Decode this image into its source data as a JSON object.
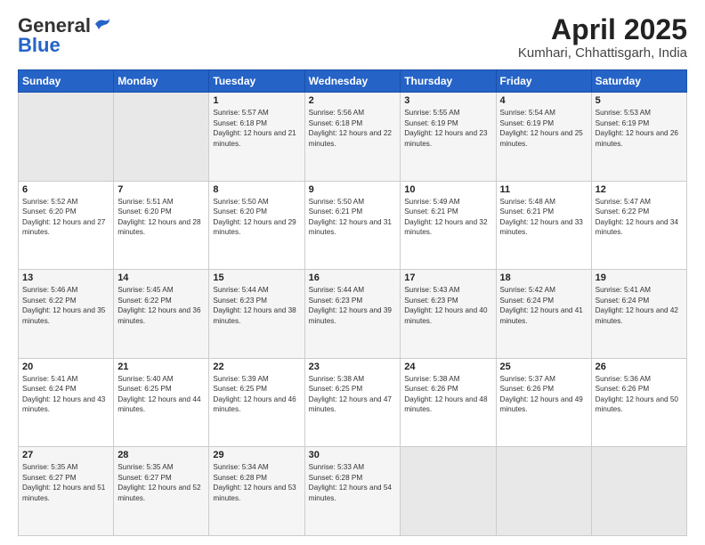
{
  "header": {
    "logo_general": "General",
    "logo_blue": "Blue",
    "title": "April 2025",
    "subtitle": "Kumhari, Chhattisgarh, India"
  },
  "weekdays": [
    "Sunday",
    "Monday",
    "Tuesday",
    "Wednesday",
    "Thursday",
    "Friday",
    "Saturday"
  ],
  "weeks": [
    [
      {
        "day": "",
        "sunrise": "",
        "sunset": "",
        "daylight": "",
        "empty": true
      },
      {
        "day": "",
        "sunrise": "",
        "sunset": "",
        "daylight": "",
        "empty": true
      },
      {
        "day": "1",
        "sunrise": "Sunrise: 5:57 AM",
        "sunset": "Sunset: 6:18 PM",
        "daylight": "Daylight: 12 hours and 21 minutes.",
        "empty": false
      },
      {
        "day": "2",
        "sunrise": "Sunrise: 5:56 AM",
        "sunset": "Sunset: 6:18 PM",
        "daylight": "Daylight: 12 hours and 22 minutes.",
        "empty": false
      },
      {
        "day": "3",
        "sunrise": "Sunrise: 5:55 AM",
        "sunset": "Sunset: 6:19 PM",
        "daylight": "Daylight: 12 hours and 23 minutes.",
        "empty": false
      },
      {
        "day": "4",
        "sunrise": "Sunrise: 5:54 AM",
        "sunset": "Sunset: 6:19 PM",
        "daylight": "Daylight: 12 hours and 25 minutes.",
        "empty": false
      },
      {
        "day": "5",
        "sunrise": "Sunrise: 5:53 AM",
        "sunset": "Sunset: 6:19 PM",
        "daylight": "Daylight: 12 hours and 26 minutes.",
        "empty": false
      }
    ],
    [
      {
        "day": "6",
        "sunrise": "Sunrise: 5:52 AM",
        "sunset": "Sunset: 6:20 PM",
        "daylight": "Daylight: 12 hours and 27 minutes.",
        "empty": false
      },
      {
        "day": "7",
        "sunrise": "Sunrise: 5:51 AM",
        "sunset": "Sunset: 6:20 PM",
        "daylight": "Daylight: 12 hours and 28 minutes.",
        "empty": false
      },
      {
        "day": "8",
        "sunrise": "Sunrise: 5:50 AM",
        "sunset": "Sunset: 6:20 PM",
        "daylight": "Daylight: 12 hours and 29 minutes.",
        "empty": false
      },
      {
        "day": "9",
        "sunrise": "Sunrise: 5:50 AM",
        "sunset": "Sunset: 6:21 PM",
        "daylight": "Daylight: 12 hours and 31 minutes.",
        "empty": false
      },
      {
        "day": "10",
        "sunrise": "Sunrise: 5:49 AM",
        "sunset": "Sunset: 6:21 PM",
        "daylight": "Daylight: 12 hours and 32 minutes.",
        "empty": false
      },
      {
        "day": "11",
        "sunrise": "Sunrise: 5:48 AM",
        "sunset": "Sunset: 6:21 PM",
        "daylight": "Daylight: 12 hours and 33 minutes.",
        "empty": false
      },
      {
        "day": "12",
        "sunrise": "Sunrise: 5:47 AM",
        "sunset": "Sunset: 6:22 PM",
        "daylight": "Daylight: 12 hours and 34 minutes.",
        "empty": false
      }
    ],
    [
      {
        "day": "13",
        "sunrise": "Sunrise: 5:46 AM",
        "sunset": "Sunset: 6:22 PM",
        "daylight": "Daylight: 12 hours and 35 minutes.",
        "empty": false
      },
      {
        "day": "14",
        "sunrise": "Sunrise: 5:45 AM",
        "sunset": "Sunset: 6:22 PM",
        "daylight": "Daylight: 12 hours and 36 minutes.",
        "empty": false
      },
      {
        "day": "15",
        "sunrise": "Sunrise: 5:44 AM",
        "sunset": "Sunset: 6:23 PM",
        "daylight": "Daylight: 12 hours and 38 minutes.",
        "empty": false
      },
      {
        "day": "16",
        "sunrise": "Sunrise: 5:44 AM",
        "sunset": "Sunset: 6:23 PM",
        "daylight": "Daylight: 12 hours and 39 minutes.",
        "empty": false
      },
      {
        "day": "17",
        "sunrise": "Sunrise: 5:43 AM",
        "sunset": "Sunset: 6:23 PM",
        "daylight": "Daylight: 12 hours and 40 minutes.",
        "empty": false
      },
      {
        "day": "18",
        "sunrise": "Sunrise: 5:42 AM",
        "sunset": "Sunset: 6:24 PM",
        "daylight": "Daylight: 12 hours and 41 minutes.",
        "empty": false
      },
      {
        "day": "19",
        "sunrise": "Sunrise: 5:41 AM",
        "sunset": "Sunset: 6:24 PM",
        "daylight": "Daylight: 12 hours and 42 minutes.",
        "empty": false
      }
    ],
    [
      {
        "day": "20",
        "sunrise": "Sunrise: 5:41 AM",
        "sunset": "Sunset: 6:24 PM",
        "daylight": "Daylight: 12 hours and 43 minutes.",
        "empty": false
      },
      {
        "day": "21",
        "sunrise": "Sunrise: 5:40 AM",
        "sunset": "Sunset: 6:25 PM",
        "daylight": "Daylight: 12 hours and 44 minutes.",
        "empty": false
      },
      {
        "day": "22",
        "sunrise": "Sunrise: 5:39 AM",
        "sunset": "Sunset: 6:25 PM",
        "daylight": "Daylight: 12 hours and 46 minutes.",
        "empty": false
      },
      {
        "day": "23",
        "sunrise": "Sunrise: 5:38 AM",
        "sunset": "Sunset: 6:25 PM",
        "daylight": "Daylight: 12 hours and 47 minutes.",
        "empty": false
      },
      {
        "day": "24",
        "sunrise": "Sunrise: 5:38 AM",
        "sunset": "Sunset: 6:26 PM",
        "daylight": "Daylight: 12 hours and 48 minutes.",
        "empty": false
      },
      {
        "day": "25",
        "sunrise": "Sunrise: 5:37 AM",
        "sunset": "Sunset: 6:26 PM",
        "daylight": "Daylight: 12 hours and 49 minutes.",
        "empty": false
      },
      {
        "day": "26",
        "sunrise": "Sunrise: 5:36 AM",
        "sunset": "Sunset: 6:26 PM",
        "daylight": "Daylight: 12 hours and 50 minutes.",
        "empty": false
      }
    ],
    [
      {
        "day": "27",
        "sunrise": "Sunrise: 5:35 AM",
        "sunset": "Sunset: 6:27 PM",
        "daylight": "Daylight: 12 hours and 51 minutes.",
        "empty": false
      },
      {
        "day": "28",
        "sunrise": "Sunrise: 5:35 AM",
        "sunset": "Sunset: 6:27 PM",
        "daylight": "Daylight: 12 hours and 52 minutes.",
        "empty": false
      },
      {
        "day": "29",
        "sunrise": "Sunrise: 5:34 AM",
        "sunset": "Sunset: 6:28 PM",
        "daylight": "Daylight: 12 hours and 53 minutes.",
        "empty": false
      },
      {
        "day": "30",
        "sunrise": "Sunrise: 5:33 AM",
        "sunset": "Sunset: 6:28 PM",
        "daylight": "Daylight: 12 hours and 54 minutes.",
        "empty": false
      },
      {
        "day": "",
        "sunrise": "",
        "sunset": "",
        "daylight": "",
        "empty": true
      },
      {
        "day": "",
        "sunrise": "",
        "sunset": "",
        "daylight": "",
        "empty": true
      },
      {
        "day": "",
        "sunrise": "",
        "sunset": "",
        "daylight": "",
        "empty": true
      }
    ]
  ]
}
